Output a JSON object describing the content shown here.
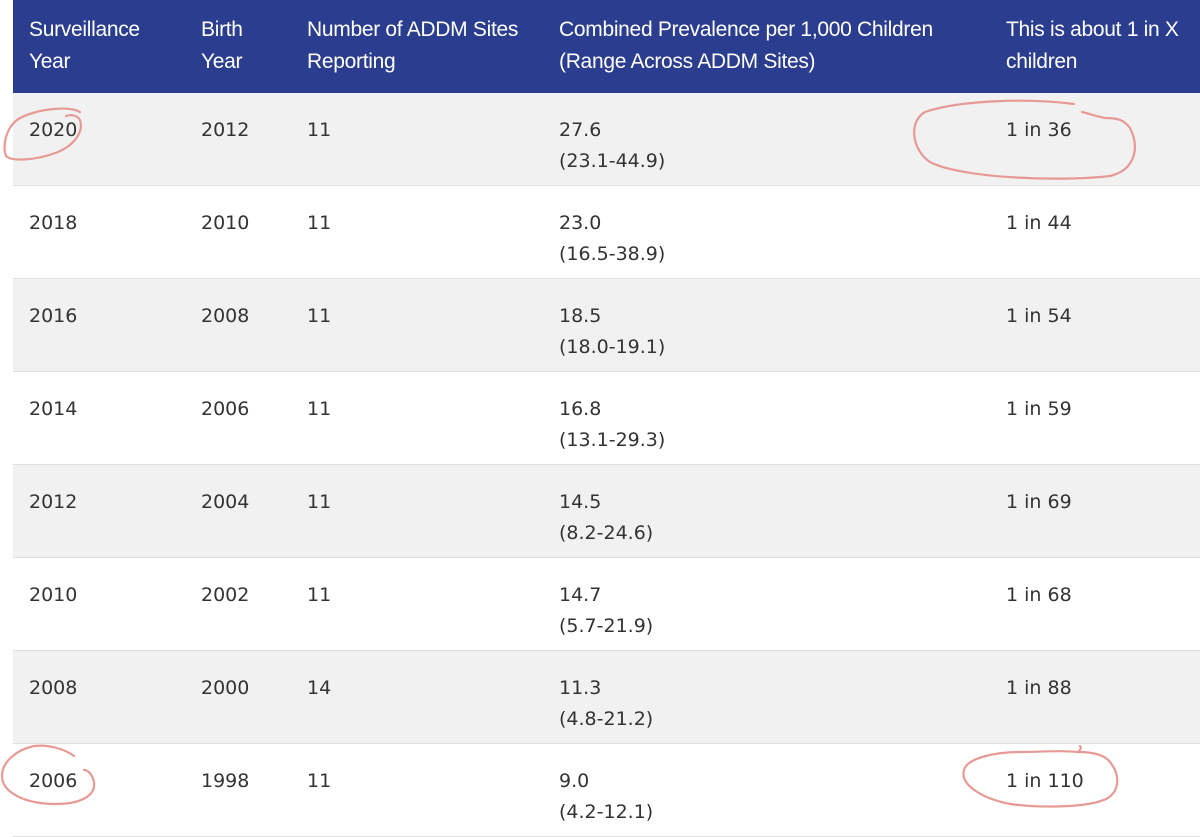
{
  "table": {
    "headers": [
      [
        "Surveillance",
        "Year"
      ],
      [
        "Birth",
        "Year"
      ],
      [
        "Number of ADDM Sites",
        "Reporting"
      ],
      [
        "Combined Prevalence per 1,000 Children",
        "(Range Across ADDM Sites)"
      ],
      [
        "This is about 1 in X",
        "children"
      ]
    ],
    "rows": [
      {
        "surveillance_year": "2020",
        "birth_year": "2012",
        "sites": "11",
        "prevalence": "27.6",
        "range": "(23.1-44.9)",
        "one_in_x": "1 in 36"
      },
      {
        "surveillance_year": "2018",
        "birth_year": "2010",
        "sites": "11",
        "prevalence": "23.0",
        "range": "(16.5-38.9)",
        "one_in_x": "1 in 44"
      },
      {
        "surveillance_year": "2016",
        "birth_year": "2008",
        "sites": "11",
        "prevalence": "18.5",
        "range": "(18.0-19.1)",
        "one_in_x": "1 in 54"
      },
      {
        "surveillance_year": "2014",
        "birth_year": "2006",
        "sites": "11",
        "prevalence": "16.8",
        "range": "(13.1-29.3)",
        "one_in_x": "1 in 59"
      },
      {
        "surveillance_year": "2012",
        "birth_year": "2004",
        "sites": "11",
        "prevalence": "14.5",
        "range": "(8.2-24.6)",
        "one_in_x": "1 in 69"
      },
      {
        "surveillance_year": "2010",
        "birth_year": "2002",
        "sites": "11",
        "prevalence": "14.7",
        "range": "(5.7-21.9)",
        "one_in_x": "1 in 68"
      },
      {
        "surveillance_year": "2008",
        "birth_year": "2000",
        "sites": "14",
        "prevalence": "11.3",
        "range": "(4.8-21.2)",
        "one_in_x": "1 in 88"
      },
      {
        "surveillance_year": "2006",
        "birth_year": "1998",
        "sites": "11",
        "prevalence": "9.0",
        "range": "(4.2-12.1)",
        "one_in_x": "1 in 110"
      }
    ]
  },
  "colors": {
    "header_bg": "#2b3d8f",
    "header_text": "#ffffff",
    "row_shade": "#f1f1f1",
    "annotation_stroke": "#e79a95"
  }
}
